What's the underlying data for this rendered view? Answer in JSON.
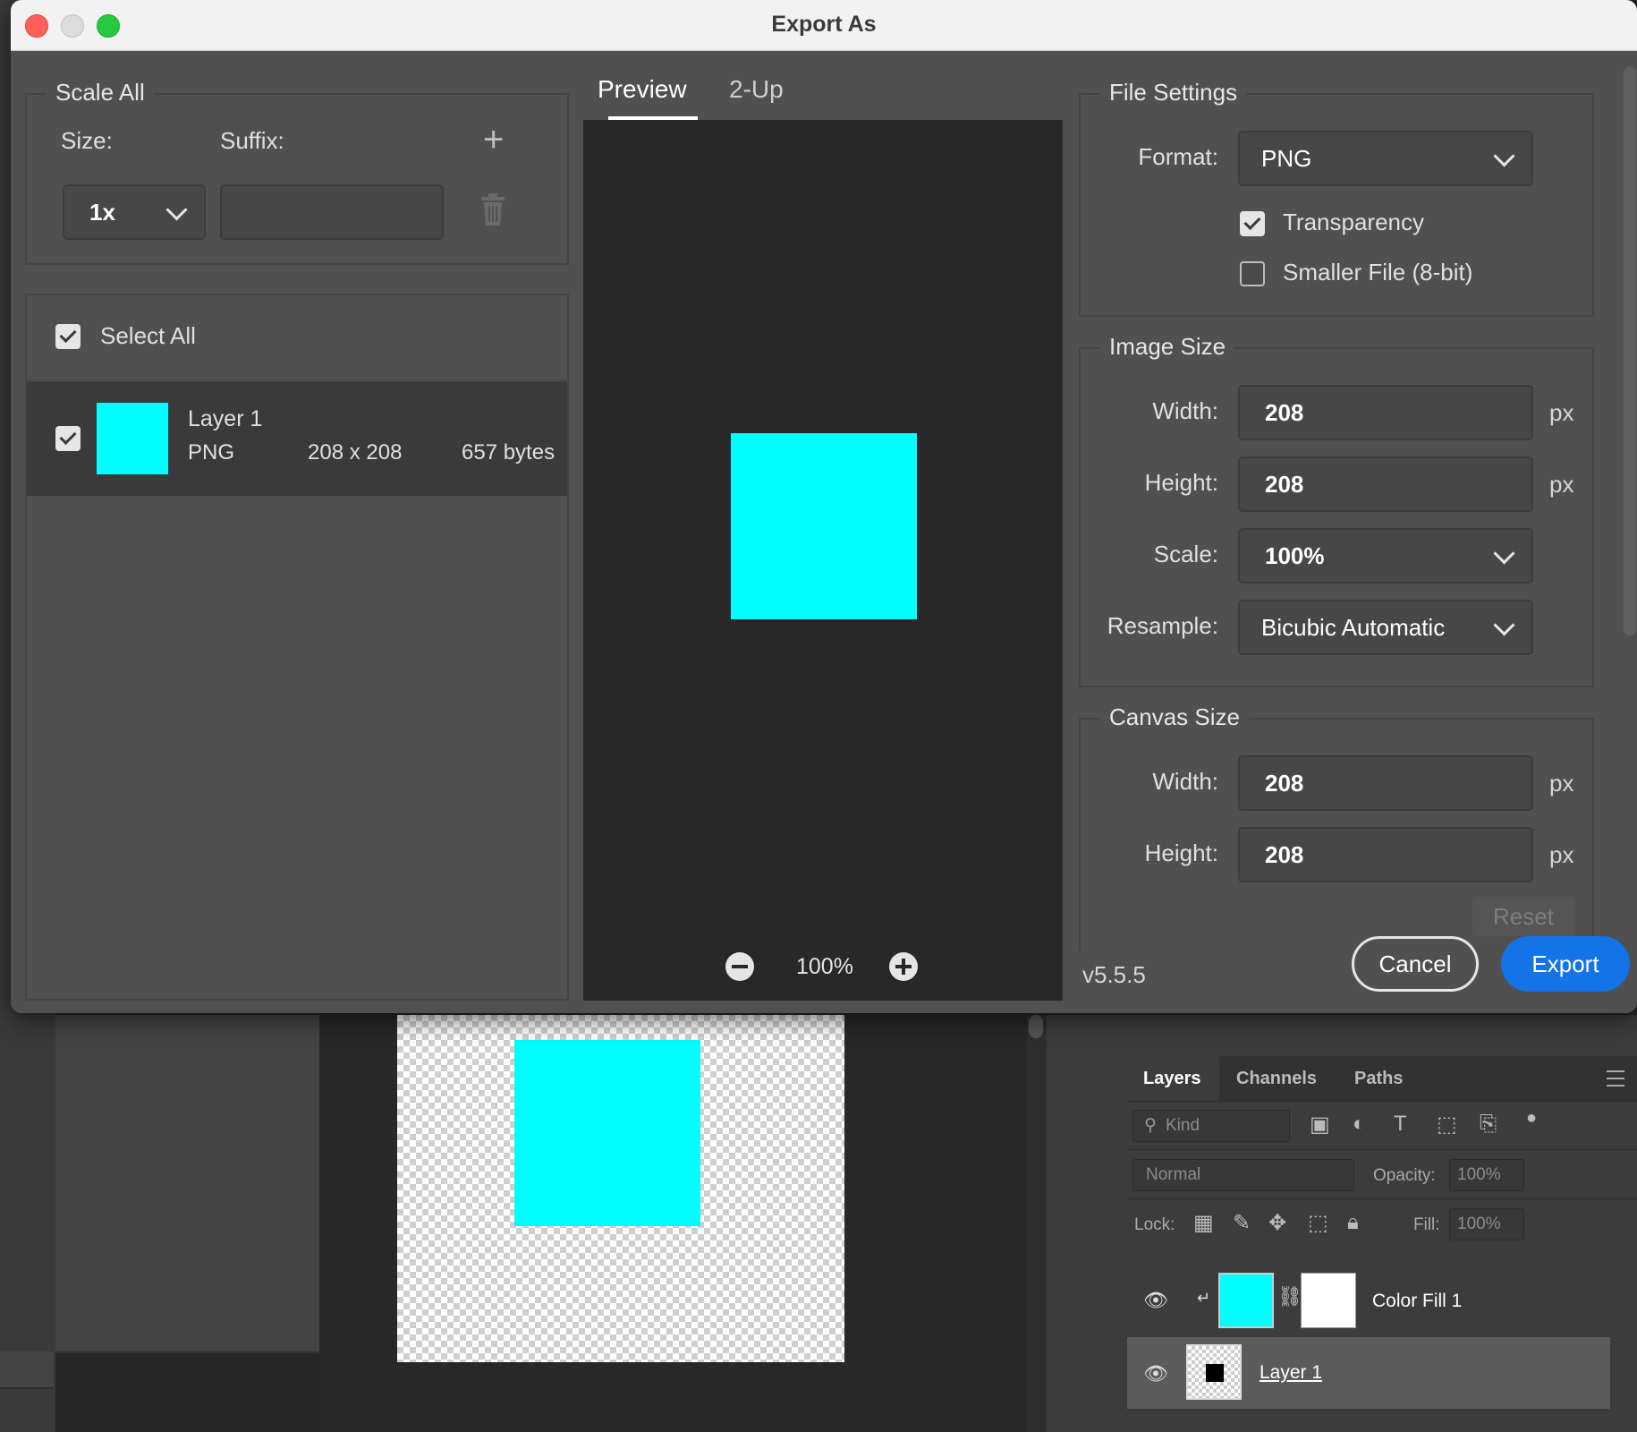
{
  "dialog": {
    "title": "Export As"
  },
  "scale_all": {
    "legend": "Scale All",
    "size_label": "Size:",
    "suffix_label": "Suffix:",
    "size_value": "1x",
    "suffix_value": "",
    "add_icon": "plus-icon",
    "delete_icon": "trash-icon"
  },
  "layers_list": {
    "select_all_label": "Select All",
    "select_all_checked": true,
    "items": [
      {
        "name": "Layer 1",
        "format": "PNG",
        "dimensions": "208 x 208",
        "size": "657 bytes",
        "checked": true,
        "thumb_color": "#00ffff"
      }
    ]
  },
  "preview": {
    "tabs": [
      "Preview",
      "2-Up"
    ],
    "active_tab": "Preview",
    "zoom": "100%",
    "image_color": "#00ffff"
  },
  "file_settings": {
    "legend": "File Settings",
    "format_label": "Format:",
    "format_value": "PNG",
    "transparency_label": "Transparency",
    "transparency_checked": true,
    "smaller_file_label": "Smaller File (8-bit)",
    "smaller_file_checked": false
  },
  "image_size": {
    "legend": "Image Size",
    "width_label": "Width:",
    "width_value": "208",
    "height_label": "Height:",
    "height_value": "208",
    "scale_label": "Scale:",
    "scale_value": "100%",
    "resample_label": "Resample:",
    "resample_value": "Bicubic Automatic",
    "unit": "px"
  },
  "canvas_size": {
    "legend": "Canvas Size",
    "width_label": "Width:",
    "width_value": "208",
    "height_label": "Height:",
    "height_value": "208",
    "unit": "px",
    "reset_label": "Reset"
  },
  "footer": {
    "version": "v5.5.5",
    "cancel_label": "Cancel",
    "export_label": "Export"
  },
  "layers_panel": {
    "tabs": [
      "Layers",
      "Channels",
      "Paths"
    ],
    "active_tab": "Layers",
    "filter_placeholder": "Kind",
    "blend_mode": "Normal",
    "opacity_label": "Opacity:",
    "opacity_value": "100%",
    "lock_label": "Lock:",
    "fill_label": "Fill:",
    "fill_value": "100%",
    "layers": [
      {
        "name": "Color Fill 1",
        "visible": true
      },
      {
        "name": "Layer 1",
        "visible": true,
        "selected": true
      }
    ]
  },
  "colors": {
    "accent": "#1473e6",
    "cyan": "#00ffff",
    "dialog_bg": "#505050",
    "preview_bg": "#282828"
  }
}
